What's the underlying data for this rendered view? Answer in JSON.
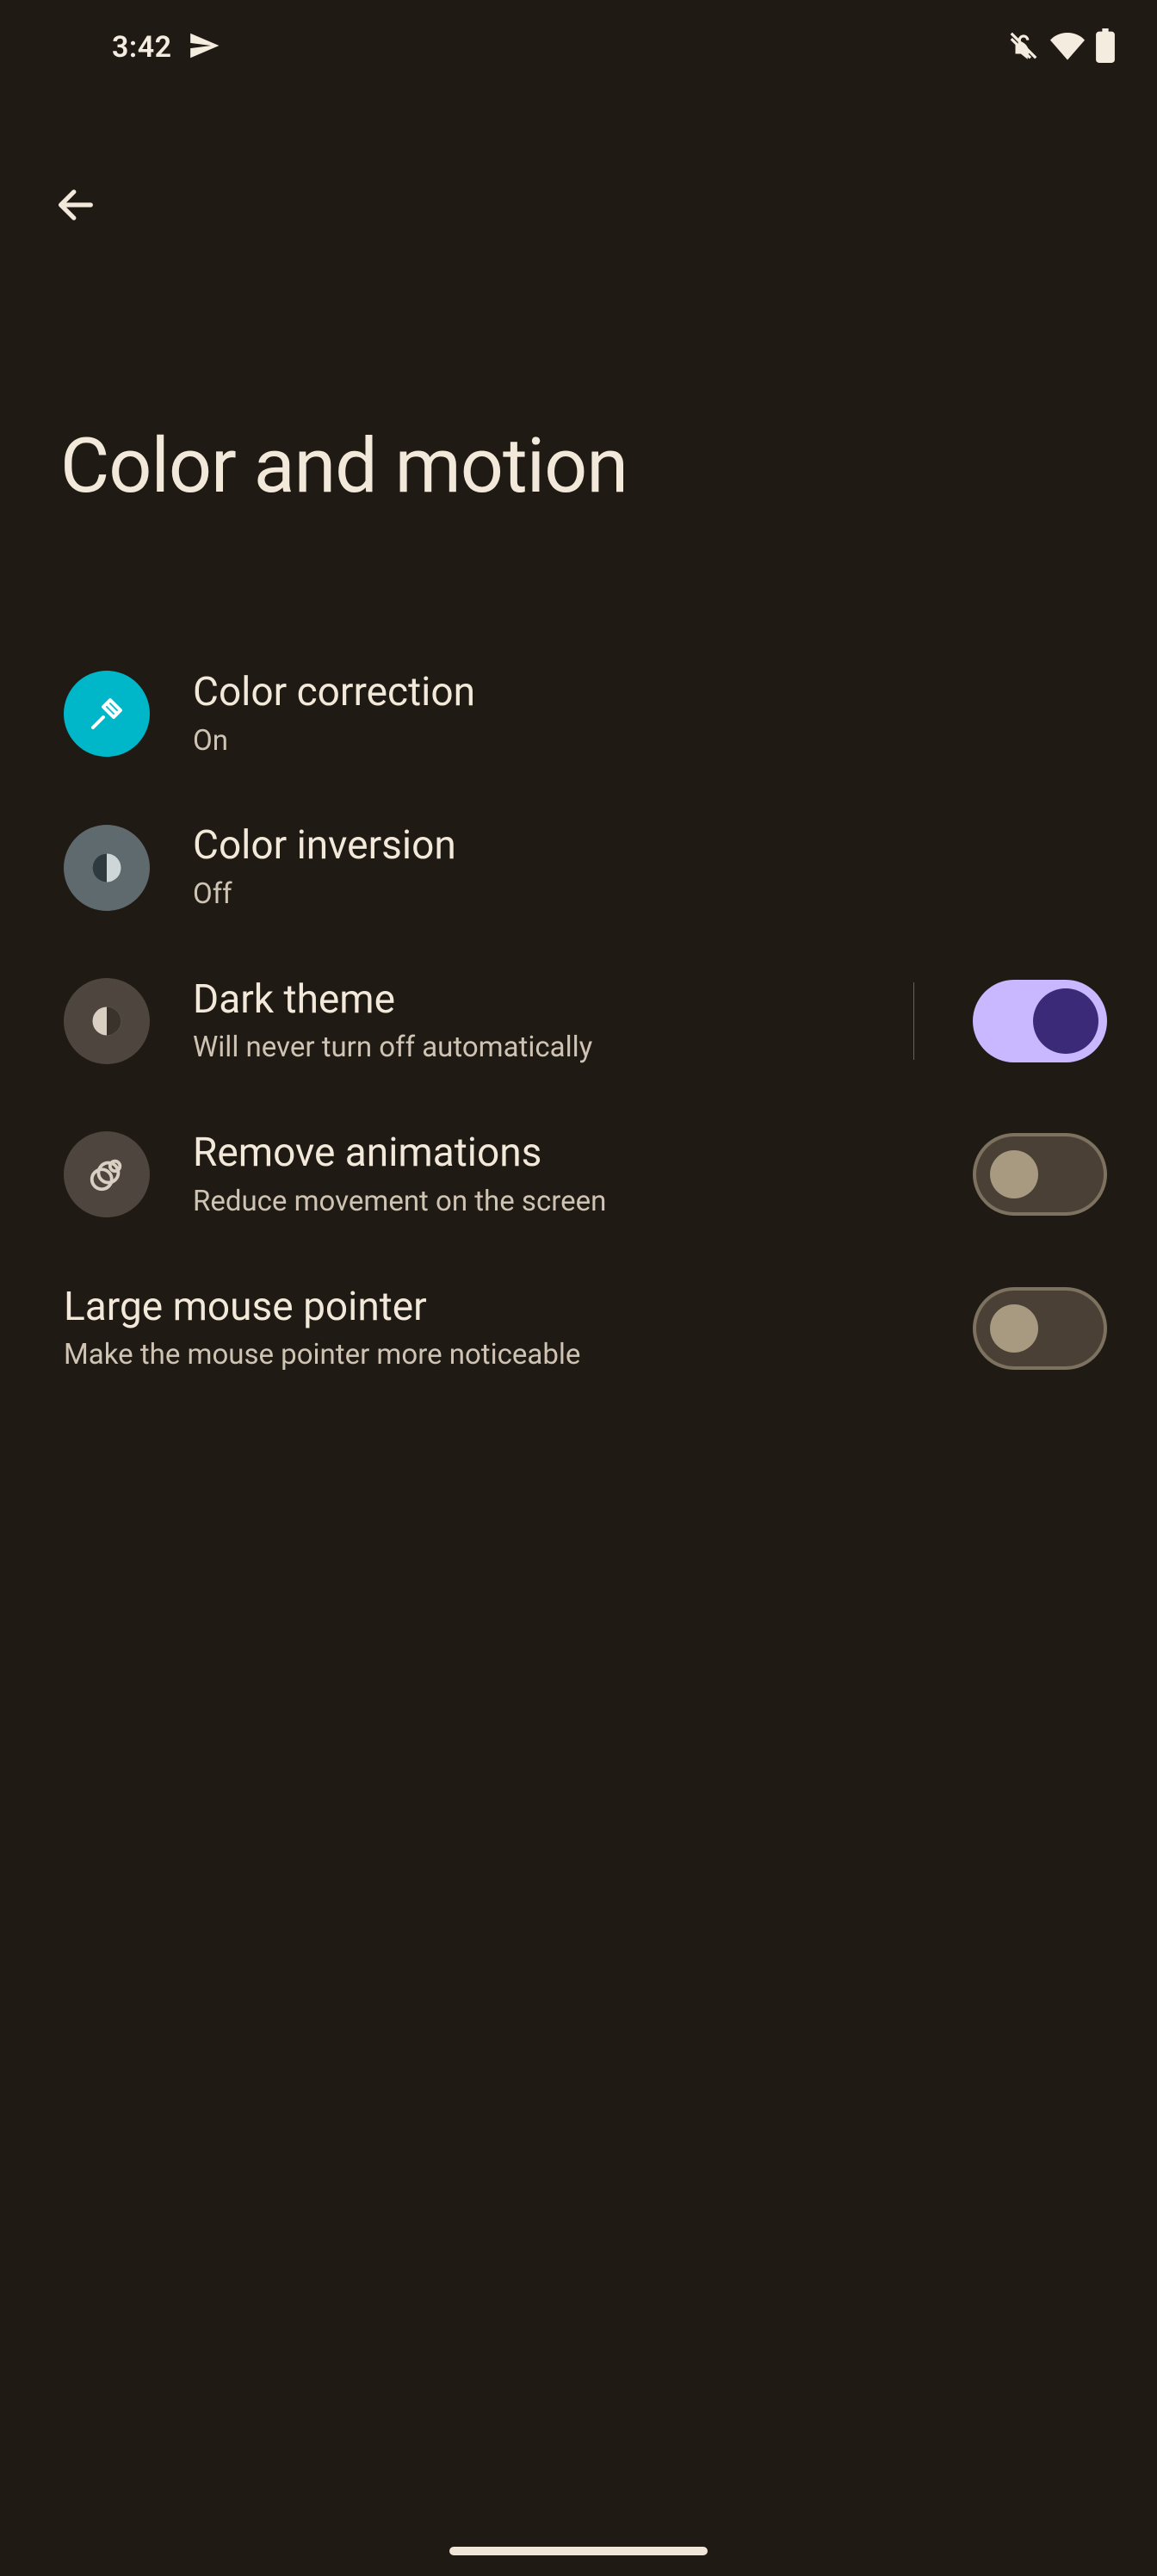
{
  "status": {
    "time": "3:42"
  },
  "page": {
    "title": "Color and motion"
  },
  "rows": {
    "color_correction": {
      "title": "Color correction",
      "sub": "On"
    },
    "color_inversion": {
      "title": "Color inversion",
      "sub": "Off"
    },
    "dark_theme": {
      "title": "Dark theme",
      "sub": "Will never turn off automatically",
      "on": true
    },
    "remove_anim": {
      "title": "Remove animations",
      "sub": "Reduce movement on the screen",
      "on": false
    },
    "large_pointer": {
      "title": "Large mouse pointer",
      "sub": "Make the mouse pointer more noticeable",
      "on": false
    }
  }
}
